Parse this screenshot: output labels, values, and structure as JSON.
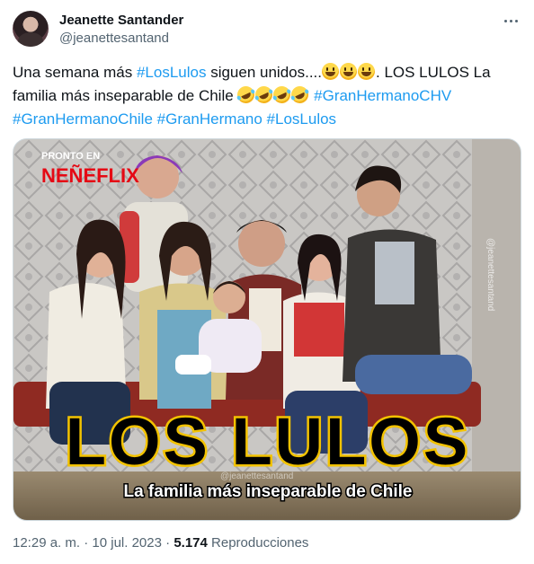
{
  "author": {
    "name": "Jeanette Santander",
    "handle": "@jeanettesantand"
  },
  "tweet": {
    "line1_text": "Una semana más ",
    "line1_tag": "#LosLulos",
    "line1_text2": " siguen unidos....",
    "line1_text3": ". LOS LULOS La",
    "line2_text": "familia más inseparable de Chile ",
    "line2_tag": "#GranHermanoCHV",
    "line3_tag1": "#GranHermanoChile",
    "line3_tag2": "#GranHermano",
    "line3_tag3": "#LosLulos"
  },
  "media": {
    "badge_top": "PRONTO EN",
    "badge_brand": "NEÑEFLIX",
    "title": "LOS LULOS",
    "subtitle": "La familia más inseparable de Chile",
    "watermark": "@jeanettesantand",
    "side_watermark": "@jeanettesantand"
  },
  "meta": {
    "time": "12:29 a. m.",
    "separator": " · ",
    "date": "10 jul. 2023",
    "views_count": "5.174",
    "views_label": " Reproducciones"
  },
  "colors": {
    "link": "#1d9bf0",
    "secondary": "#536471",
    "title_yellow": "#f2c200"
  }
}
